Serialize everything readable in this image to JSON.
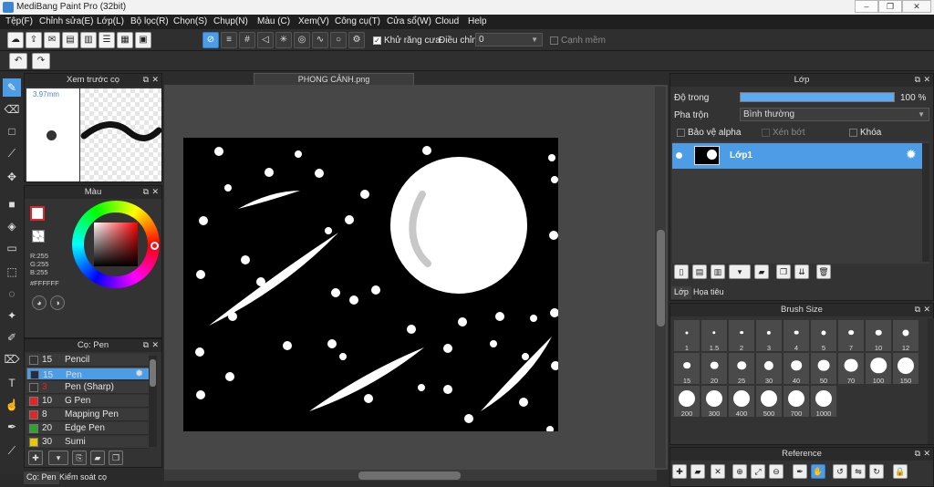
{
  "window": {
    "title": "MediBang Paint Pro (32bit)",
    "minimize": "–",
    "maximize": "❐",
    "close": "✕"
  },
  "menu": [
    "Tệp(F)",
    "Chỉnh sửa(E)",
    "Lớp(L)",
    "Bộ lọc(R)",
    "Chọn(S)",
    "Chụp(N)",
    "Màu (C)",
    "Xem(V)",
    "Công cụ(T)",
    "Cửa sổ(W)",
    "Cloud",
    "Help"
  ],
  "toolbar": {
    "antialias_label": "Khử răng cưa",
    "antialias_checked": true,
    "adjust_label": "Điều chỉnh",
    "adjust_value": "0",
    "sharp_edge_label": "Cạnh mềm",
    "sharp_edge_checked": false
  },
  "brush_preview": {
    "title": "Xem trước cọ",
    "size": "3.97mm"
  },
  "color_panel": {
    "title": "Màu",
    "r": "R:255",
    "g": "G:255",
    "b": "B:255",
    "hex": "#FFFFFF",
    "fg": "#ffffff"
  },
  "brush_panel": {
    "title": "Cọ: Pen",
    "items": [
      {
        "size": "15",
        "name": "Pencil",
        "color": "#333333",
        "selected": false
      },
      {
        "size": "15",
        "name": "Pen",
        "color": "#1f2f4a",
        "selected": true
      },
      {
        "size": "3",
        "name": "Pen (Sharp)",
        "color": "#333333",
        "selected": false
      },
      {
        "size": "10",
        "name": "G Pen",
        "color": "#e0262a",
        "selected": false
      },
      {
        "size": "8",
        "name": "Mapping Pen",
        "color": "#e0262a",
        "selected": false
      },
      {
        "size": "20",
        "name": "Edge Pen",
        "color": "#2ba52b",
        "selected": false
      },
      {
        "size": "30",
        "name": "Sumi",
        "color": "#e8c800",
        "selected": false
      }
    ],
    "tabs": [
      "Cọ: Pen",
      "Kiểm soát cọ"
    ]
  },
  "document": {
    "tab": "PHONG CẢNH.png"
  },
  "layer_panel": {
    "title": "Lớp",
    "opacity_label": "Độ trong",
    "opacity_value": "100 %",
    "opacity": 1.0,
    "blend_label": "Pha trộn",
    "blend_value": "Bình thường",
    "protect_alpha": "Bảo vệ alpha",
    "clipping": "Xén bớt",
    "lock": "Khóa",
    "layer_name": "Lớp1",
    "tabs": [
      "Lớp",
      "Họa tiêu"
    ]
  },
  "brush_size": {
    "title": "Brush Size",
    "sizes": [
      "1",
      "1.5",
      "2",
      "3",
      "4",
      "5",
      "7",
      "10",
      "12",
      "15",
      "20",
      "25",
      "30",
      "40",
      "50",
      "70",
      "100",
      "150",
      "200",
      "300",
      "400",
      "500",
      "700",
      "1000"
    ]
  },
  "reference": {
    "title": "Reference"
  },
  "colors": {
    "accent": "#4c9de6",
    "bg": "#2b2b2b",
    "panel": "#333333"
  }
}
